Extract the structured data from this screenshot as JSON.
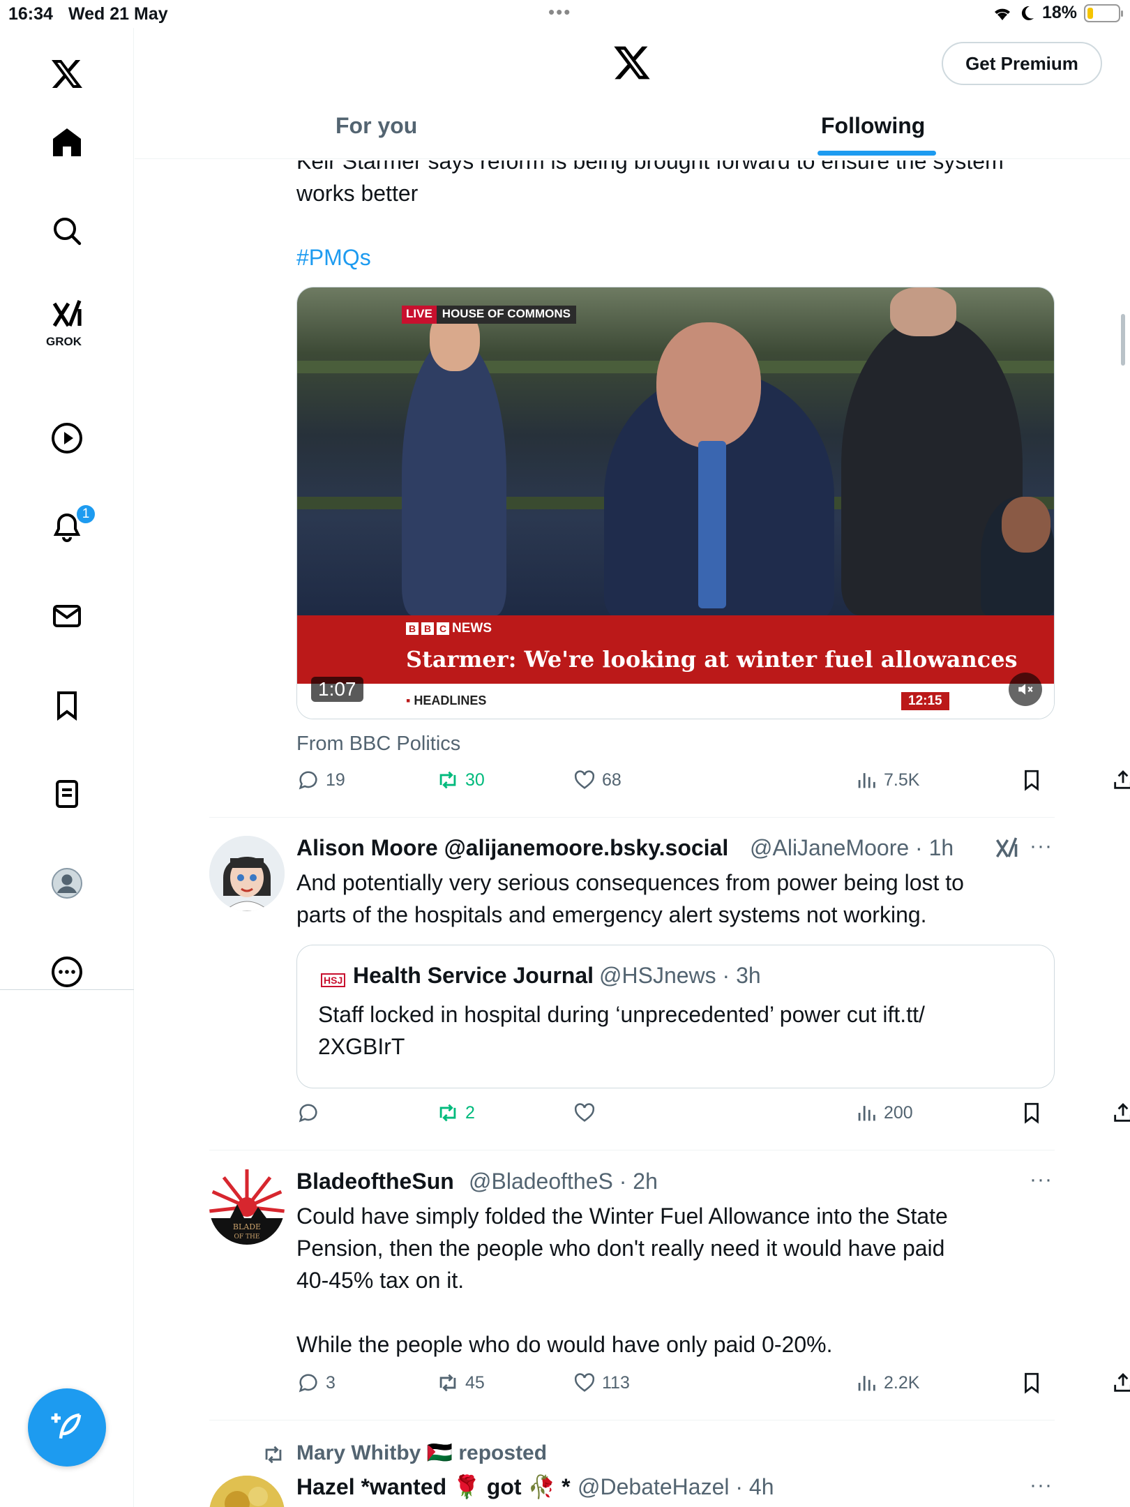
{
  "status_bar": {
    "time": "16:34",
    "date": "Wed 21 May",
    "battery": "18%",
    "battery_level": 0.18
  },
  "sidebar": {
    "items": [
      {
        "name": "home"
      },
      {
        "name": "search"
      },
      {
        "name": "grok",
        "label": "GROK"
      },
      {
        "name": "video"
      },
      {
        "name": "notifications",
        "badge": "1"
      },
      {
        "name": "messages"
      },
      {
        "name": "bookmarks"
      },
      {
        "name": "lists"
      },
      {
        "name": "profile"
      },
      {
        "name": "more"
      }
    ]
  },
  "header": {
    "premium_label": "Get Premium",
    "tabs": [
      {
        "label": "For you"
      },
      {
        "label": "Following"
      }
    ]
  },
  "tweet1": {
    "text_line1": "Keir Starmer says reform is being brought forward to ensure the system",
    "text_line2": "works better",
    "hashtag": "#PMQs",
    "video": {
      "live": "LIVE",
      "location": "HOUSE OF COMMONS",
      "network": "NEWS",
      "headline": "Starmer: We're looking at winter fuel allowances",
      "ticker": "HEADLINES",
      "clock": "12:15",
      "duration": "1:07"
    },
    "source": "From BBC Politics",
    "replies": "19",
    "reposts": "30",
    "likes": "68",
    "views": "7.5K"
  },
  "tweet2": {
    "name": "Alison Moore @alijanemoore.bsky.social",
    "handle_time": "@AliJaneMoore · 1h",
    "text_line1": "And potentially very serious consequences from power being lost to",
    "text_line2": "parts of the hospitals and emergency alert systems not working.",
    "quote": {
      "logo": "HSJ",
      "name": "Health Service Journal",
      "handle_time": "@HSJnews · 3h",
      "text_line1": "Staff locked in hospital during ‘unprecedented’ power cut ift.tt/",
      "text_line2": "2XGBIrT"
    },
    "replies": "",
    "reposts": "2",
    "likes": "",
    "views": "200"
  },
  "tweet3": {
    "name": "BladeoftheSun",
    "handle_time": "@BladeoftheS · 2h",
    "text_line1": "Could have simply folded the Winter Fuel Allowance into the State",
    "text_line2": "Pension, then the people who don't really need it would have paid",
    "text_line3": "40-45% tax on it.",
    "text_line4": "While the people who do would have only paid 0-20%.",
    "replies": "3",
    "reposts": "45",
    "likes": "113",
    "views": "2.2K"
  },
  "tweet4": {
    "repost_by": "Mary Whitby 🇵🇸 reposted",
    "name": "Hazel *wanted 🌹 got 🥀 *",
    "handle_time": "@DebateHazel · 4h"
  },
  "colors": {
    "accent": "#1d9bf0",
    "repost": "#00ba7c",
    "text": "#0f1419",
    "muted": "#536471",
    "bbc_red": "#bb1919"
  }
}
